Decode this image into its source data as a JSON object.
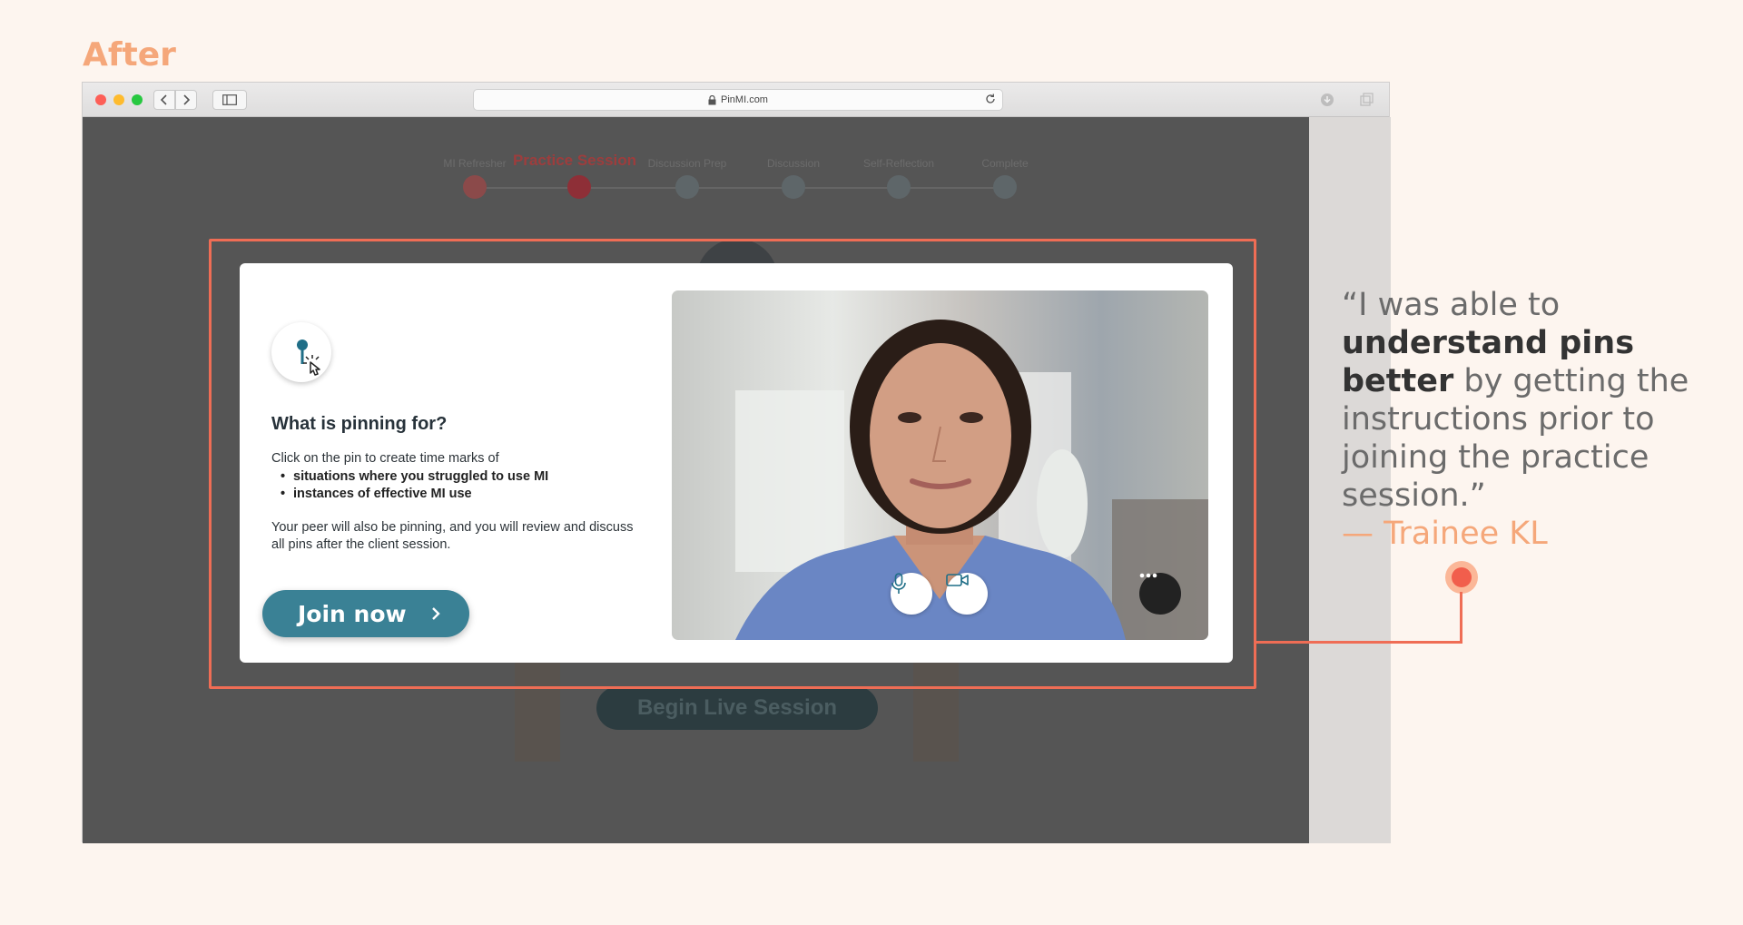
{
  "page_label": "After",
  "browser": {
    "url": "PinMI.com"
  },
  "stepper": {
    "steps": [
      {
        "label": "MI Refresher",
        "state": "done"
      },
      {
        "label": "Practice Session",
        "state": "active"
      },
      {
        "label": "Discussion Prep",
        "state": "upcoming"
      },
      {
        "label": "Discussion",
        "state": "upcoming"
      },
      {
        "label": "Self-Reflection",
        "state": "upcoming"
      },
      {
        "label": "Complete",
        "state": "upcoming"
      }
    ]
  },
  "background": {
    "begin_button": "Begin Live Session"
  },
  "modal": {
    "title": "What is pinning for?",
    "intro": "Click on the pin to create time marks of",
    "bullets": [
      "situations where you struggled to use MI",
      "instances of effective MI use"
    ],
    "peer_text": "Your peer will also be pinning, and you will review and discuss all pins after the client session.",
    "join_label": "Join now"
  },
  "video": {
    "controls": [
      "microphone-icon",
      "video-camera-icon",
      "more-options-icon"
    ]
  },
  "testimonial": {
    "open_quote_part": "“I was able to ",
    "bold_part": "understand pins better",
    "rest_part": " by getting the instructions prior to joining the practice session.”",
    "author": "— Trainee KL"
  },
  "colors": {
    "accent_orange": "#f5a77a",
    "highlight_red": "#ef6d55",
    "button_teal": "#3a8195"
  }
}
